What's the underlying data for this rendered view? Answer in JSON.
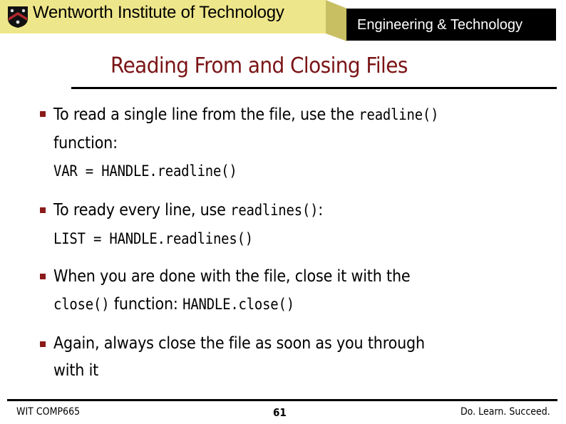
{
  "header": {
    "institution": "Wentworth Institute of Technology",
    "department": "Engineering & Technology",
    "logo_icon": "crest-shield-icon",
    "colors": {
      "yellow_bar": "#eee68a",
      "fold": "#c8bf62",
      "black_bar": "#000000",
      "accent": "#7a1416"
    }
  },
  "slide": {
    "title": "Reading From and Closing Files",
    "bullets": [
      {
        "lines": [
          {
            "segments": [
              {
                "text": "To read a single line from the file, use the ",
                "mono": false
              },
              {
                "text": "readline()",
                "mono": true
              }
            ]
          },
          {
            "segments": [
              {
                "text": "function:",
                "mono": false
              }
            ]
          },
          {
            "segments": [
              {
                "text": "VAR = HANDLE.readline()",
                "mono": true
              }
            ]
          }
        ]
      },
      {
        "lines": [
          {
            "segments": [
              {
                "text": "To ready every line, use ",
                "mono": false
              },
              {
                "text": "readlines()",
                "mono": true
              },
              {
                "text": ":",
                "mono": false
              }
            ]
          },
          {
            "segments": [
              {
                "text": "LIST = HANDLE.readlines()",
                "mono": true
              }
            ]
          }
        ]
      },
      {
        "lines": [
          {
            "segments": [
              {
                "text": "When you are done with the file, close it with the",
                "mono": false
              }
            ]
          },
          {
            "segments": [
              {
                "text": "close()",
                "mono": true
              },
              {
                "text": " function: ",
                "mono": false
              },
              {
                "text": "HANDLE.close()",
                "mono": true
              }
            ]
          }
        ]
      },
      {
        "lines": [
          {
            "segments": [
              {
                "text": "Again, always close the file as soon as you through",
                "mono": false
              }
            ]
          },
          {
            "segments": [
              {
                "text": "with it",
                "mono": false
              }
            ]
          }
        ]
      }
    ]
  },
  "footer": {
    "course": "WIT COMP665",
    "page_number": "61",
    "motto": "Do. Learn. Succeed."
  }
}
